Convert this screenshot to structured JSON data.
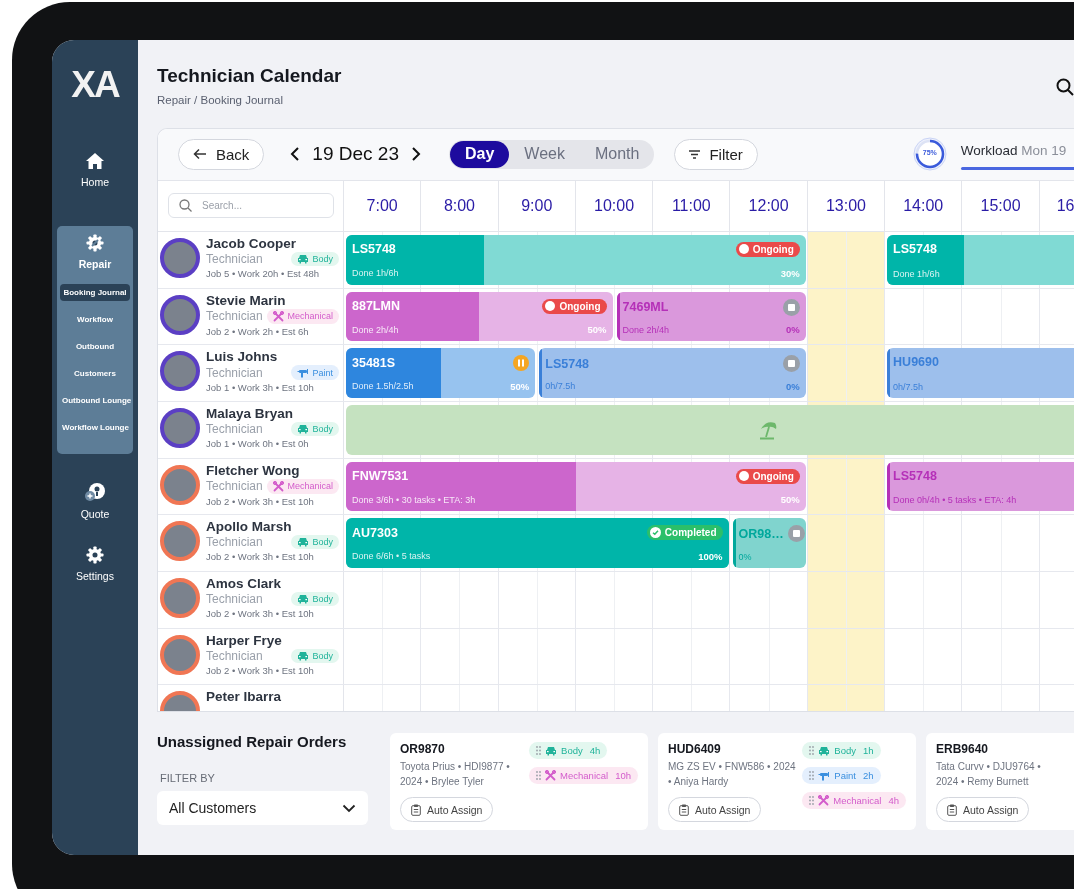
{
  "sidebar": {
    "logo": "XA",
    "items": [
      {
        "kind": "link",
        "label": "Home",
        "selected": false
      },
      {
        "kind": "group",
        "label": "Repair",
        "expanded": true,
        "children": [
          {
            "label": "Booking Journal",
            "selected": true
          },
          {
            "label": "Workflow",
            "selected": false
          },
          {
            "label": "Outbound",
            "selected": false
          },
          {
            "label": "Customers",
            "selected": false
          },
          {
            "label": "Outbound Lounge",
            "selected": false
          },
          {
            "label": "Workflow Lounge",
            "selected": false
          }
        ]
      },
      {
        "kind": "link",
        "label": "Quote",
        "selected": false
      },
      {
        "kind": "link",
        "label": "Settings",
        "selected": false
      }
    ]
  },
  "header": {
    "title": "Technician Calendar",
    "breadcrumb": "Repair / Booking Journal"
  },
  "toolbar": {
    "back": "Back",
    "date": "19 Dec 23",
    "views": [
      {
        "label": "Day",
        "selected": true
      },
      {
        "label": "Week",
        "selected": false
      },
      {
        "label": "Month",
        "selected": false
      }
    ],
    "filter": "Filter"
  },
  "workload": {
    "level": 0.75,
    "percent": "75%",
    "label": "**Workload** Mon 19"
  },
  "search": {
    "placeholder": "Search..."
  },
  "hours": [
    {
      "label": "7:00",
      "highlighted": false
    },
    {
      "label": "8:00",
      "highlighted": false
    },
    {
      "label": "9:00",
      "highlighted": false
    },
    {
      "label": "10:00",
      "highlighted": false
    },
    {
      "label": "11:00",
      "highlighted": false
    },
    {
      "label": "12:00",
      "highlighted": false
    },
    {
      "label": "13:00",
      "highlighted": true
    },
    {
      "label": "14:00",
      "highlighted": false
    },
    {
      "label": "15:00",
      "highlighted": false
    },
    {
      "label": "16",
      "highlighted": false
    }
  ],
  "technicians": [
    {
      "name": "Jacob Cooper",
      "role": "Technician",
      "skill": {
        "kind": "body",
        "label": "Body"
      },
      "stats": "Job 5 • Work 20h • Est 48h",
      "color": "#5b3fc4",
      "events": [
        {
          "kind": "job",
          "id": "LS5748",
          "color": "#00b5a9",
          "level": 0.3,
          "status": {
            "kind": "ongoing",
            "label": "Ongoing"
          },
          "detail": "Done 1h/6h",
          "percent": "30%"
        },
        {
          "kind": "job",
          "id": "LS5748",
          "color": "#00b5a9",
          "level": 0.2,
          "detail": "Done 1h/6h"
        }
      ]
    },
    {
      "name": "Stevie Marin",
      "role": "Technician",
      "skill": {
        "kind": "mechanical",
        "label": "Mechanical"
      },
      "stats": "Job 2 • Work 2h • Est 6h",
      "color": "#5b3fc4",
      "events": [
        {
          "kind": "job",
          "id": "887LMN",
          "color": "#cc66cc",
          "level": 0.5,
          "status": {
            "kind": "ongoing",
            "label": "Ongoing"
          },
          "detail": "Done 2h/4h",
          "percent": "50%"
        },
        {
          "kind": "job",
          "id": "7469ML",
          "color": "#b530b8",
          "level": 0,
          "status": {
            "kind": "stopped"
          },
          "detail": "Done 2h/4h",
          "percent": "0%"
        }
      ]
    },
    {
      "name": "Luis Johns",
      "role": "Technician",
      "skill": {
        "kind": "paint",
        "label": "Paint"
      },
      "stats": "Job 1 • Work 3h • Est 10h",
      "color": "#5b3fc4",
      "events": [
        {
          "kind": "job",
          "id": "35481S",
          "color": "#2e86de",
          "level": 0.5,
          "status": {
            "kind": "paused"
          },
          "detail": "Done 1.5h/2.5h",
          "percent": "50%"
        },
        {
          "kind": "job",
          "id": "LS5748",
          "color": "#3a7fd8",
          "level": 0,
          "status": {
            "kind": "stopped"
          },
          "detail": "0h/7.5h",
          "percent": "0%"
        },
        {
          "kind": "job",
          "id": "HU9690",
          "color": "#3a7fd8",
          "level": 0,
          "detail": "0h/7.5h"
        }
      ]
    },
    {
      "name": "Malaya Bryan",
      "role": "Technician",
      "skill": {
        "kind": "body",
        "label": "Body"
      },
      "stats": "Job 1 • Work 0h • Est 0h",
      "color": "#5b3fc4",
      "events": [
        {
          "kind": "leave"
        }
      ]
    },
    {
      "name": "Fletcher Wong",
      "role": "Technician",
      "skill": {
        "kind": "mechanical",
        "label": "Mechanical"
      },
      "stats": "Job 2 • Work 3h • Est 10h",
      "color": "#f07654",
      "events": [
        {
          "kind": "job",
          "id": "FNW7531",
          "color": "#cc66cc",
          "level": 0.5,
          "status": {
            "kind": "ongoing",
            "label": "Ongoing"
          },
          "detail": "Done 3/6h • 30 tasks • ETA: 3h",
          "percent": "50%"
        },
        {
          "kind": "job",
          "id": "LS5748",
          "color": "#b530b8",
          "level": 0,
          "detail": "Done 0h/4h • 5 tasks • ETA: 4h"
        }
      ]
    },
    {
      "name": "Apollo Marsh",
      "role": "Technician",
      "skill": {
        "kind": "body",
        "label": "Body"
      },
      "stats": "Job 2 • Work 3h • Est 10h",
      "color": "#f07654",
      "events": [
        {
          "kind": "job",
          "id": "AU7303",
          "color": "#00b5a9",
          "level": 1,
          "status": {
            "kind": "completed",
            "label": "Completed"
          },
          "detail": "Done 6/6h • 5 tasks",
          "percent": "100%"
        },
        {
          "kind": "job",
          "id": "OR98…",
          "color": "#00a89c",
          "level": 0,
          "status": {
            "kind": "stopped"
          },
          "detail": "0%"
        }
      ]
    },
    {
      "name": "Amos Clark",
      "role": "Technician",
      "skill": {
        "kind": "body",
        "label": "Body"
      },
      "stats": "Job 2 • Work 3h • Est 10h",
      "color": "#f07654"
    },
    {
      "name": "Harper Frye",
      "role": "Technician",
      "skill": {
        "kind": "body",
        "label": "Body"
      },
      "stats": "Job 2 • Work 3h • Est 10h",
      "color": "#f07654"
    },
    {
      "name": "Peter Ibarra",
      "color": "#f07654"
    }
  ],
  "unassigned": {
    "title": "Unassigned Repair Orders",
    "filter_label": "FILTER BY",
    "filter_value": "All Customers",
    "orders": [
      {
        "id": "OR9870",
        "details": "Toyota Prius • HDI9877 • 2024 • Brylee Tyler",
        "tags": [
          {
            "kind": "body",
            "label": "Body",
            "hours": "4h"
          },
          {
            "kind": "mechanical",
            "label": "Mechanical",
            "hours": "10h"
          }
        ],
        "action": "Auto Assign"
      },
      {
        "id": "HUD6409",
        "details": "MG ZS EV • FNW586 • 2024 • Aniya Hardy",
        "tags": [
          {
            "kind": "body",
            "label": "Body",
            "hours": "1h"
          },
          {
            "kind": "paint",
            "label": "Paint",
            "hours": "2h"
          },
          {
            "kind": "mechanical",
            "label": "Mechanical",
            "hours": "4h"
          }
        ],
        "action": "Auto Assign"
      },
      {
        "id": "ERB9640",
        "details": "Tata Curvv • DJU9764 • 2024 • Remy Burnett",
        "action": "Auto Assign"
      }
    ]
  }
}
